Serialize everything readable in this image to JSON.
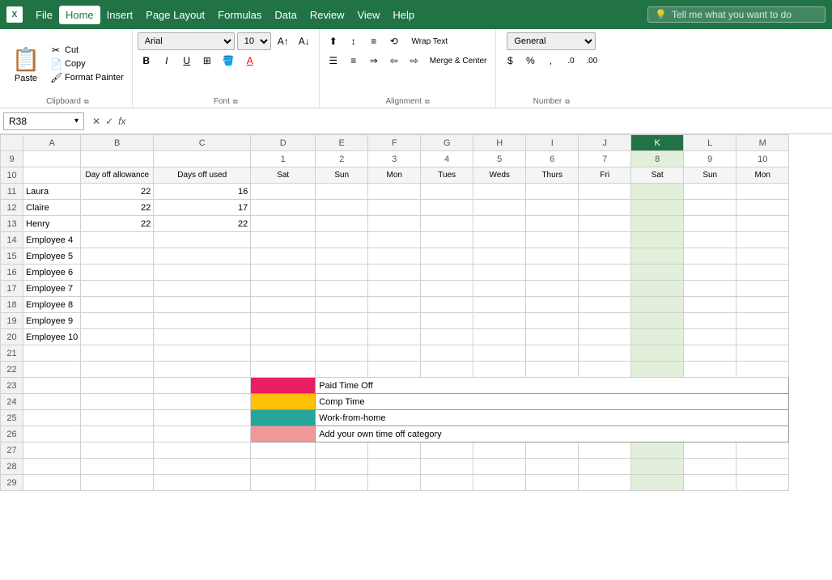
{
  "app": {
    "icon": "X",
    "title": "Excel"
  },
  "menu": {
    "items": [
      "File",
      "Home",
      "Insert",
      "Page Layout",
      "Formulas",
      "Data",
      "Review",
      "View",
      "Help"
    ],
    "active": "Home",
    "search_placeholder": "Tell me what you want to do"
  },
  "clipboard": {
    "paste_label": "Paste",
    "cut_label": "Cut",
    "copy_label": "Copy",
    "format_painter_label": "Format Painter",
    "group_label": "Clipboard"
  },
  "font": {
    "face": "Arial",
    "size": "10",
    "bold_label": "B",
    "italic_label": "I",
    "underline_label": "U",
    "increase_label": "A↑",
    "decrease_label": "A↓",
    "group_label": "Font"
  },
  "alignment": {
    "wrap_text_label": "Wrap Text",
    "merge_center_label": "Merge & Center",
    "group_label": "Alignment"
  },
  "number": {
    "format": "General",
    "group_label": "Number"
  },
  "formula_bar": {
    "cell_ref": "R38",
    "formula": ""
  },
  "columns": {
    "headers": [
      "A",
      "B",
      "C",
      "D",
      "E",
      "F",
      "G",
      "H",
      "I",
      "J",
      "K",
      "L",
      "M"
    ],
    "widths": [
      28,
      90,
      120,
      80,
      65,
      65,
      65,
      65,
      65,
      65,
      65,
      65,
      65
    ]
  },
  "rows": {
    "start": 9,
    "header_row": 10,
    "data": [
      {
        "row": 9,
        "cells": [
          "",
          "",
          "",
          "1",
          "2",
          "3",
          "4",
          "5",
          "6",
          "7",
          "8",
          "9",
          "10"
        ]
      },
      {
        "row": 10,
        "cells": [
          "",
          "Day off allowance",
          "Days off used",
          "Sat",
          "Sun",
          "Mon",
          "Tues",
          "Weds",
          "Thurs",
          "Fri",
          "Sat",
          "Sun",
          "Mon"
        ]
      },
      {
        "row": 11,
        "cells": [
          "Laura",
          "22",
          "16",
          "",
          "",
          "",
          "",
          "",
          "",
          "",
          "",
          "",
          ""
        ]
      },
      {
        "row": 12,
        "cells": [
          "Claire",
          "22",
          "17",
          "",
          "",
          "",
          "",
          "",
          "",
          "",
          "",
          "",
          ""
        ]
      },
      {
        "row": 13,
        "cells": [
          "Henry",
          "22",
          "22",
          "",
          "",
          "",
          "",
          "",
          "",
          "",
          "",
          "",
          ""
        ]
      },
      {
        "row": 14,
        "cells": [
          "Employee 4",
          "",
          "",
          "",
          "",
          "",
          "",
          "",
          "",
          "",
          "",
          "",
          ""
        ]
      },
      {
        "row": 15,
        "cells": [
          "Employee 5",
          "",
          "",
          "",
          "",
          "",
          "",
          "",
          "",
          "",
          "",
          "",
          ""
        ]
      },
      {
        "row": 16,
        "cells": [
          "Employee 6",
          "",
          "",
          "",
          "",
          "",
          "",
          "",
          "",
          "",
          "",
          "",
          ""
        ]
      },
      {
        "row": 17,
        "cells": [
          "Employee 7",
          "",
          "",
          "",
          "",
          "",
          "",
          "",
          "",
          "",
          "",
          "",
          ""
        ]
      },
      {
        "row": 18,
        "cells": [
          "Employee 8",
          "",
          "",
          "",
          "",
          "",
          "",
          "",
          "",
          "",
          "",
          "",
          ""
        ]
      },
      {
        "row": 19,
        "cells": [
          "Employee 9",
          "",
          "",
          "",
          "",
          "",
          "",
          "",
          "",
          "",
          "",
          "",
          ""
        ]
      },
      {
        "row": 20,
        "cells": [
          "Employee 10",
          "",
          "",
          "",
          "",
          "",
          "",
          "",
          "",
          "",
          "",
          "",
          ""
        ]
      },
      {
        "row": 21,
        "cells": [
          "",
          "",
          "",
          "",
          "",
          "",
          "",
          "",
          "",
          "",
          "",
          "",
          ""
        ]
      },
      {
        "row": 22,
        "cells": [
          "",
          "",
          "",
          "",
          "",
          "",
          "",
          "",
          "",
          "",
          "",
          "",
          ""
        ]
      },
      {
        "row": 23,
        "cells": [
          "",
          "",
          "",
          "",
          "",
          "",
          "",
          "",
          "",
          "",
          "",
          "",
          ""
        ]
      },
      {
        "row": 24,
        "cells": [
          "",
          "",
          "",
          "",
          "",
          "",
          "",
          "",
          "",
          "",
          "",
          "",
          ""
        ]
      },
      {
        "row": 25,
        "cells": [
          "",
          "",
          "",
          "",
          "",
          "",
          "",
          "",
          "",
          "",
          "",
          "",
          ""
        ]
      },
      {
        "row": 26,
        "cells": [
          "",
          "",
          "",
          "",
          "",
          "",
          "",
          "",
          "",
          "",
          "",
          "",
          ""
        ]
      },
      {
        "row": 27,
        "cells": [
          "",
          "",
          "",
          "",
          "",
          "",
          "",
          "",
          "",
          "",
          "",
          "",
          ""
        ]
      },
      {
        "row": 28,
        "cells": [
          "",
          "",
          "",
          "",
          "",
          "",
          "",
          "",
          "",
          "",
          "",
          "",
          ""
        ]
      },
      {
        "row": 29,
        "cells": [
          "",
          "",
          "",
          "",
          "",
          "",
          "",
          "",
          "",
          "",
          "",
          "",
          ""
        ]
      }
    ]
  },
  "legend": {
    "items": [
      {
        "color": "#e91e63",
        "label": "Paid Time Off"
      },
      {
        "color": "#ffc107",
        "label": "Comp Time"
      },
      {
        "color": "#26a69a",
        "label": "Work-from-home"
      },
      {
        "color": "#ef9a9a",
        "label": "Add your own time off category"
      }
    ],
    "legend_row": 23,
    "legend_col": "D"
  },
  "active_cell": "K",
  "colors": {
    "excel_green": "#217346",
    "selected_bg": "#e2efda",
    "header_bg": "#f2f2f2",
    "active_col_header": "#217346"
  }
}
